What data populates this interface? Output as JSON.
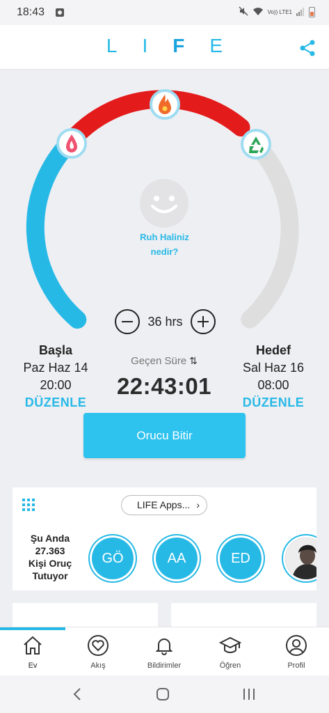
{
  "status_bar": {
    "time": "18:43",
    "network": "Vo)) LTE1"
  },
  "app": {
    "logo": [
      "L",
      "I",
      "F",
      "E"
    ]
  },
  "gauge": {
    "mood_question_line1": "Ruh Haliniz",
    "mood_question_line2": "nedir?",
    "duration_label": "36 hrs",
    "elapsed_fraction": 0.62,
    "colors": {
      "elapsed": "#27b9e6",
      "burn": "#e31b1b",
      "remaining": "#dedede"
    }
  },
  "start": {
    "heading": "Başla",
    "date": "Paz Haz 14",
    "time": "20:00",
    "edit": "DÜZENLE"
  },
  "elapsed": {
    "label": "Geçen Süre",
    "value": "22:43:01"
  },
  "goal": {
    "heading": "Hedef",
    "date": "Sal Haz 16",
    "time": "08:00",
    "edit": "DÜZENLE"
  },
  "end_button": "Orucu Bitir",
  "community": {
    "apps_label": "LIFE Apps...",
    "fasting_line1": "Şu Anda",
    "fasting_count": "27.363",
    "fasting_line2": "Kişi Oruç",
    "fasting_line3": "Tutuyor",
    "avatars": [
      "GÖ",
      "AA",
      "ED"
    ]
  },
  "nav": {
    "home": "Ev",
    "feed": "Akış",
    "notifications": "Bildirimler",
    "learn": "Öğren",
    "profile": "Profil"
  }
}
